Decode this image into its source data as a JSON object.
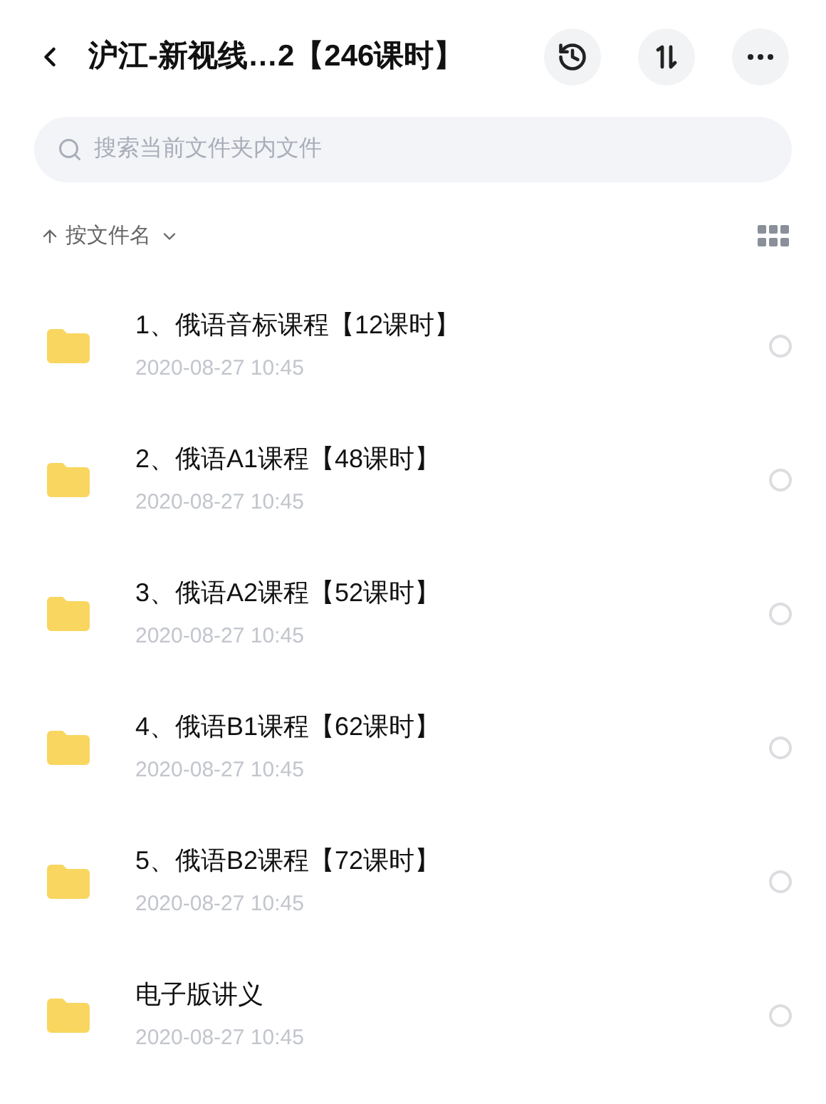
{
  "header": {
    "title": "沪江-新视线…2【246课时】"
  },
  "search": {
    "placeholder": "搜索当前文件夹内文件"
  },
  "sort": {
    "label": "按文件名"
  },
  "files": [
    {
      "name": "1、俄语音标课程【12课时】",
      "date": "2020-08-27 10:45",
      "selected": false
    },
    {
      "name": "2、俄语A1课程【48课时】",
      "date": "2020-08-27 10:45",
      "selected": false
    },
    {
      "name": "3、俄语A2课程【52课时】",
      "date": "2020-08-27 10:45",
      "selected": false
    },
    {
      "name": "4、俄语B1课程【62课时】",
      "date": "2020-08-27 10:45",
      "selected": false
    },
    {
      "name": "5、俄语B2课程【72课时】",
      "date": "2020-08-27 10:45",
      "selected": false
    },
    {
      "name": "电子版讲义",
      "date": "2020-08-27 10:45",
      "selected": false
    }
  ]
}
